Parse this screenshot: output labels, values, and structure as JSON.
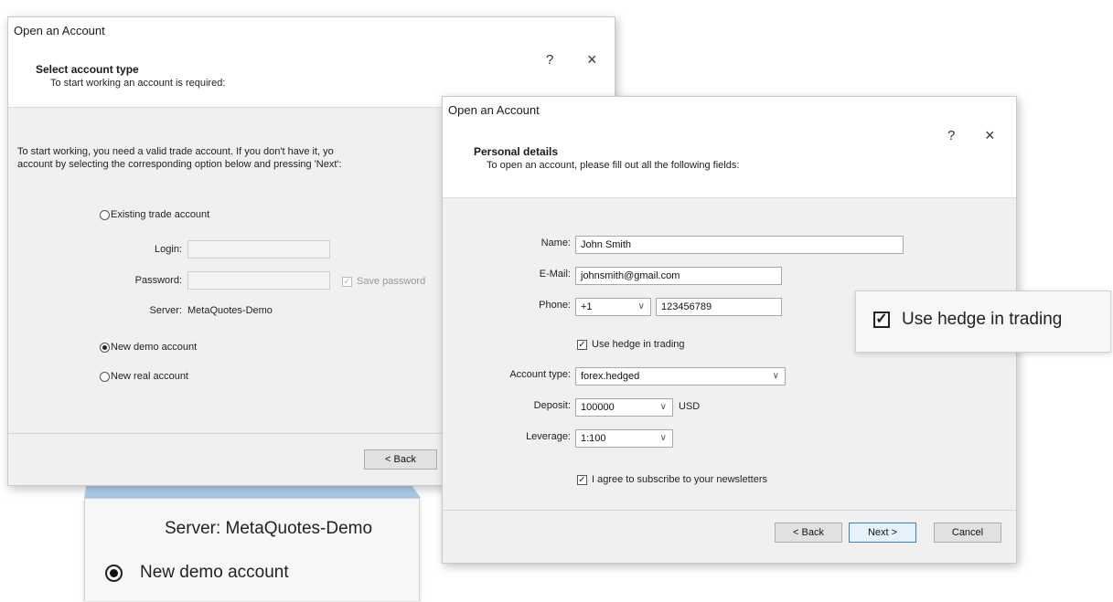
{
  "dialog_back": {
    "title": "Open an Account",
    "help": "?",
    "close": "×",
    "heading": "Select account type",
    "subheading": "To start working an account is required:",
    "intro_line1": "To start working, you need a valid trade account. If you don't have it, yo",
    "intro_line2": "account by selecting the corresponding option below and pressing 'Next':",
    "existing_label": "Existing trade account",
    "login_label": "Login:",
    "password_label": "Password:",
    "save_password_label": "Save password",
    "server_label": "Server:",
    "server_value": "MetaQuotes-Demo",
    "new_demo_label": "New demo account",
    "new_real_label": "New real account",
    "back_button": "< Back"
  },
  "dialog_front": {
    "title": "Open an Account",
    "help": "?",
    "close": "×",
    "heading": "Personal details",
    "subheading": "To open an account, please fill out all the following fields:",
    "name_label": "Name:",
    "name_value": "John Smith",
    "email_label": "E-Mail:",
    "email_value": "johnsmith@gmail.com",
    "phone_label": "Phone:",
    "phone_code": "+1",
    "phone_number": "123456789",
    "hedge_label": "Use hedge in trading",
    "account_type_label": "Account type:",
    "account_type_value": "forex.hedged",
    "deposit_label": "Deposit:",
    "deposit_value": "100000",
    "deposit_currency": "USD",
    "leverage_label": "Leverage:",
    "leverage_value": "1:100",
    "newsletter_label": "I agree to subscribe to your newsletters",
    "back_button": "< Back",
    "next_button": "Next >",
    "cancel_button": "Cancel"
  },
  "callout_hedge": {
    "label": "Use hedge in trading"
  },
  "callout_demo": {
    "server_text": "Server: MetaQuotes-Demo",
    "demo_label": "New demo account"
  },
  "icons": {
    "chevron": "chevron-down-icon",
    "check_mark": "✓"
  }
}
